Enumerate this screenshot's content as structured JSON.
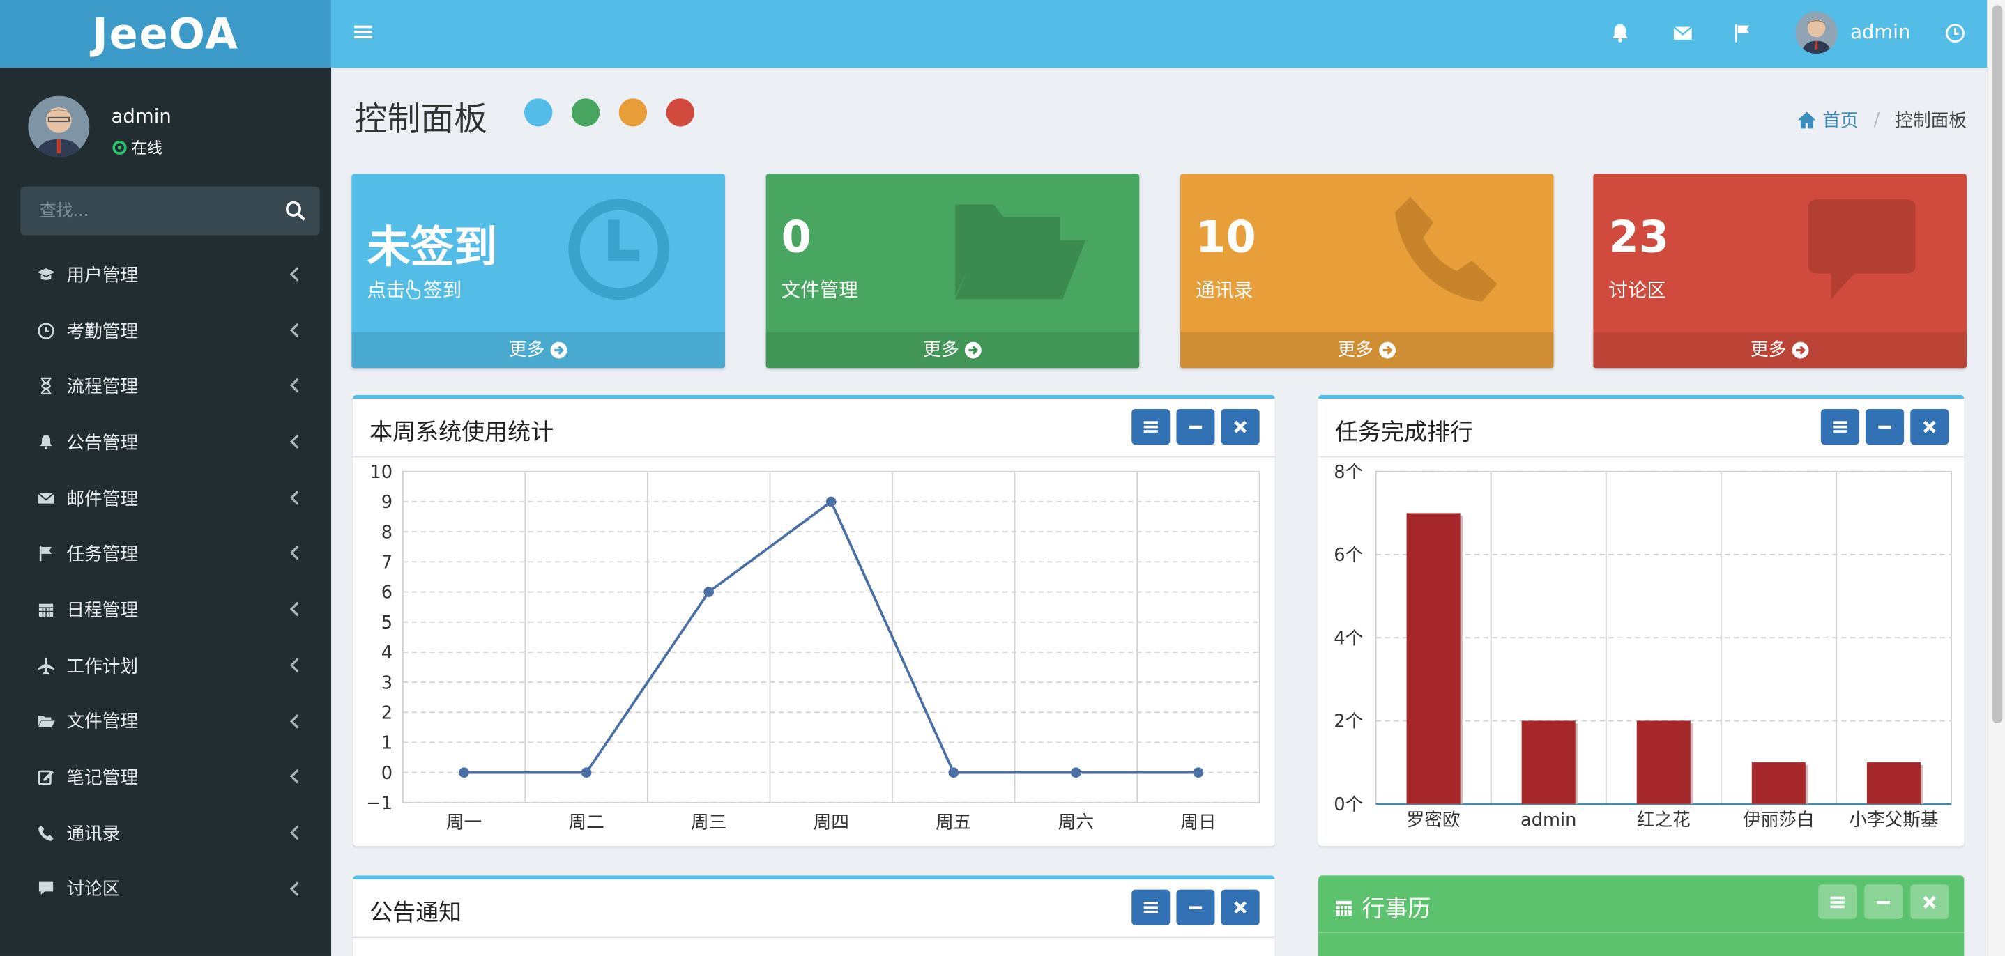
{
  "app": {
    "title": "JeeOA"
  },
  "header": {
    "username": "admin",
    "icons": [
      "bars-icon",
      "bell-icon",
      "envelope-icon",
      "flag-icon",
      "avatar",
      "clock-icon"
    ]
  },
  "sidebar": {
    "user": {
      "name": "admin",
      "status": "在线"
    },
    "search": {
      "placeholder": "查找..."
    },
    "items": [
      {
        "label": "用户管理",
        "icon": "graduation-cap-icon"
      },
      {
        "label": "考勤管理",
        "icon": "clock-icon"
      },
      {
        "label": "流程管理",
        "icon": "hourglass-icon"
      },
      {
        "label": "公告管理",
        "icon": "bell-icon"
      },
      {
        "label": "邮件管理",
        "icon": "envelope-icon"
      },
      {
        "label": "任务管理",
        "icon": "flag-icon"
      },
      {
        "label": "日程管理",
        "icon": "calendar-icon"
      },
      {
        "label": "工作计划",
        "icon": "plane-icon"
      },
      {
        "label": "文件管理",
        "icon": "folder-open-icon"
      },
      {
        "label": "笔记管理",
        "icon": "edit-icon"
      },
      {
        "label": "通讯录",
        "icon": "phone-icon"
      },
      {
        "label": "讨论区",
        "icon": "comment-icon"
      }
    ]
  },
  "page": {
    "title": "控制面板",
    "color_dots": [
      "#53bde7",
      "#48a661",
      "#e89f3a",
      "#d04b3d"
    ],
    "breadcrumb": {
      "home": "首页",
      "current": "控制面板"
    }
  },
  "tiles": [
    {
      "big": "未签到",
      "sub_prefix": "点击",
      "sub_suffix": "签到",
      "more": "更多",
      "color": "#53bde7",
      "icon": "clock-icon"
    },
    {
      "big": "0",
      "sub": "文件管理",
      "more": "更多",
      "color": "#48a661",
      "icon": "folder-open-icon"
    },
    {
      "big": "10",
      "sub": "通讯录",
      "more": "更多",
      "color": "#e89f3a",
      "icon": "phone-icon"
    },
    {
      "big": "23",
      "sub": "讨论区",
      "more": "更多",
      "color": "#d04b3d",
      "icon": "comment-icon"
    }
  ],
  "boxes": {
    "usage": {
      "title": "本周系统使用统计"
    },
    "ranking": {
      "title": "任务完成排行"
    },
    "notice": {
      "title": "公告通知"
    },
    "calendar": {
      "title": "行事历"
    }
  },
  "chart_data": [
    {
      "type": "line",
      "title": "本周系统使用统计",
      "categories": [
        "周一",
        "周二",
        "周三",
        "周四",
        "周五",
        "周六",
        "周日"
      ],
      "values": [
        0,
        0,
        6,
        9,
        0,
        0,
        0
      ],
      "ylim": [
        -1,
        10
      ],
      "yticks": [
        "−1",
        "0",
        "1",
        "2",
        "3",
        "4",
        "5",
        "6",
        "7",
        "8",
        "9",
        "10"
      ],
      "grid": true,
      "color": "#4a6fa5"
    },
    {
      "type": "bar",
      "title": "任务完成排行",
      "categories": [
        "罗密欧",
        "admin",
        "红之花",
        "伊丽莎白",
        "小李父斯基"
      ],
      "values": [
        7,
        2,
        2,
        1,
        1
      ],
      "ylim": [
        0,
        8
      ],
      "yticks": [
        "0个",
        "2个",
        "4个",
        "6个",
        "8个"
      ],
      "grid": true,
      "color": "#a6282a"
    }
  ]
}
